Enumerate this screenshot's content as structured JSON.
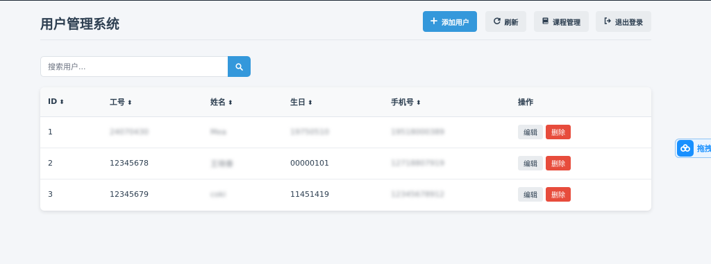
{
  "app": {
    "title": "用户管理系统"
  },
  "toolbar": {
    "add_user": "添加用户",
    "refresh": "刷新",
    "course_manage": "课程管理",
    "logout": "退出登录"
  },
  "search": {
    "placeholder": "搜索用户..."
  },
  "table": {
    "headers": {
      "id": "ID",
      "job_no": "工号",
      "name": "姓名",
      "birthday": "生日",
      "phone": "手机号",
      "actions": "操作"
    },
    "rows": [
      {
        "id": "1",
        "job_no": "24070430",
        "name": "Mea",
        "birthday": "19750510",
        "phone": "19518000389",
        "edit": "编辑",
        "delete": "删除"
      },
      {
        "id": "2",
        "job_no": "12345678",
        "name": "王晓春",
        "birthday": "00000101",
        "phone": "12718807919",
        "edit": "编辑",
        "delete": "删除"
      },
      {
        "id": "3",
        "job_no": "12345679",
        "name": "coki",
        "birthday": "11451419",
        "phone": "12345678912",
        "edit": "编辑",
        "delete": "删除"
      }
    ]
  },
  "floating_tab": {
    "label": "拖拽",
    "icon": "cloud-icon"
  },
  "colors": {
    "primary": "#3498db",
    "danger": "#e74c3c",
    "neutral": "#e9ecef",
    "text": "#2c3e50",
    "background": "#f4f6f9"
  }
}
